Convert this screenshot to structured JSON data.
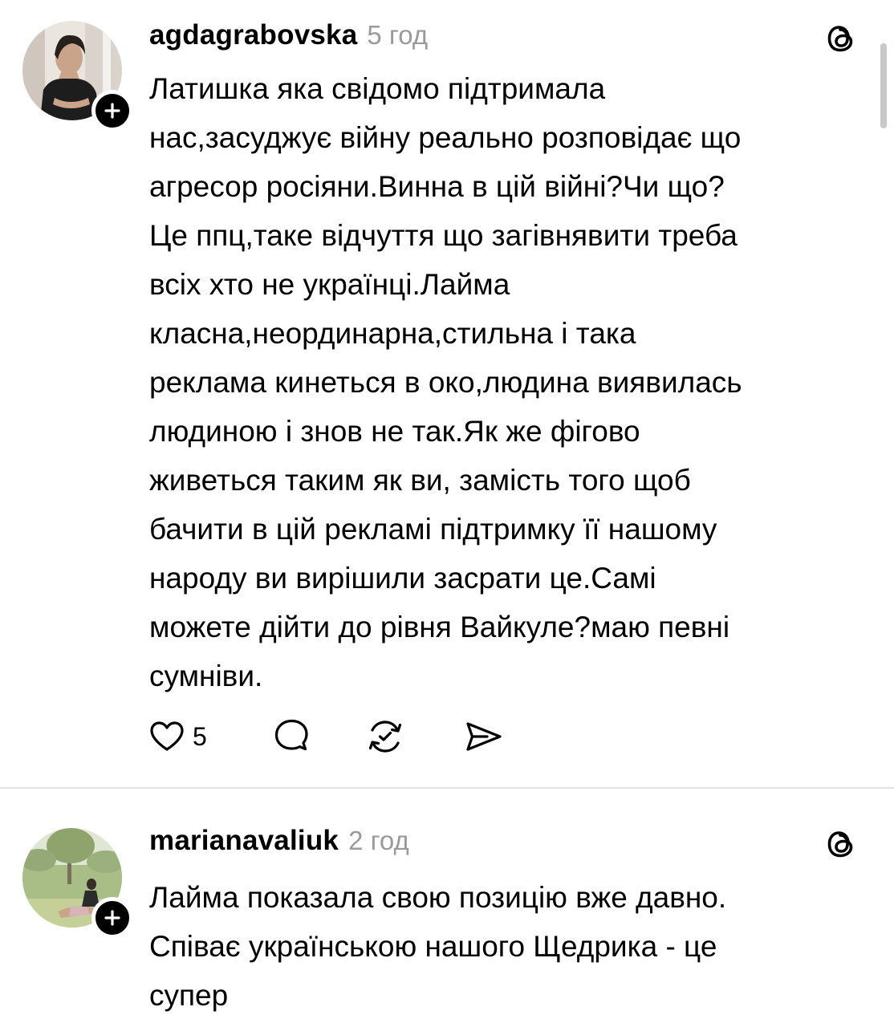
{
  "posts": [
    {
      "username": "agdagrabovska",
      "time": "5 год",
      "avatar_icon": "user-avatar-photo",
      "text": "Латишка яка свідомо підтримала\nнас,засуджує війну реально розповідає що\nагресор росіяни.Винна в цій війні?Чи що?\nЦе ппц,таке відчуття що загівнявити треба\nвсіх хто не українці.Лайма\nкласна,неординарна,стильна і така\nреклама кинеться в око,людина виявилась\nлюдиною і знов не так.Як же фігово\nживеться таким як ви, замість того щоб\nбачити в цій рекламі підтримку її нашому\nнароду ви вирішили засрати це.Самі\nможете дійти до рівня Вайкуле?маю певні\nсумніви.",
      "likes": "5"
    },
    {
      "username": "marianavaliuk",
      "time": "2 год",
      "avatar_icon": "user-avatar-photo",
      "text": "Лайма показала свою позицію вже давно.\nСпіває українською нашого Щедрика - це\nсупер"
    }
  ],
  "colors": {
    "text": "#000000",
    "muted": "#9a9a9a",
    "divider": "#e3e3e3",
    "badge": "#000000"
  },
  "icons": {
    "like": "heart-icon",
    "comment": "comment-icon",
    "repost": "repost-icon",
    "share": "share-icon",
    "threads": "threads-logo-icon",
    "follow": "plus-icon"
  }
}
